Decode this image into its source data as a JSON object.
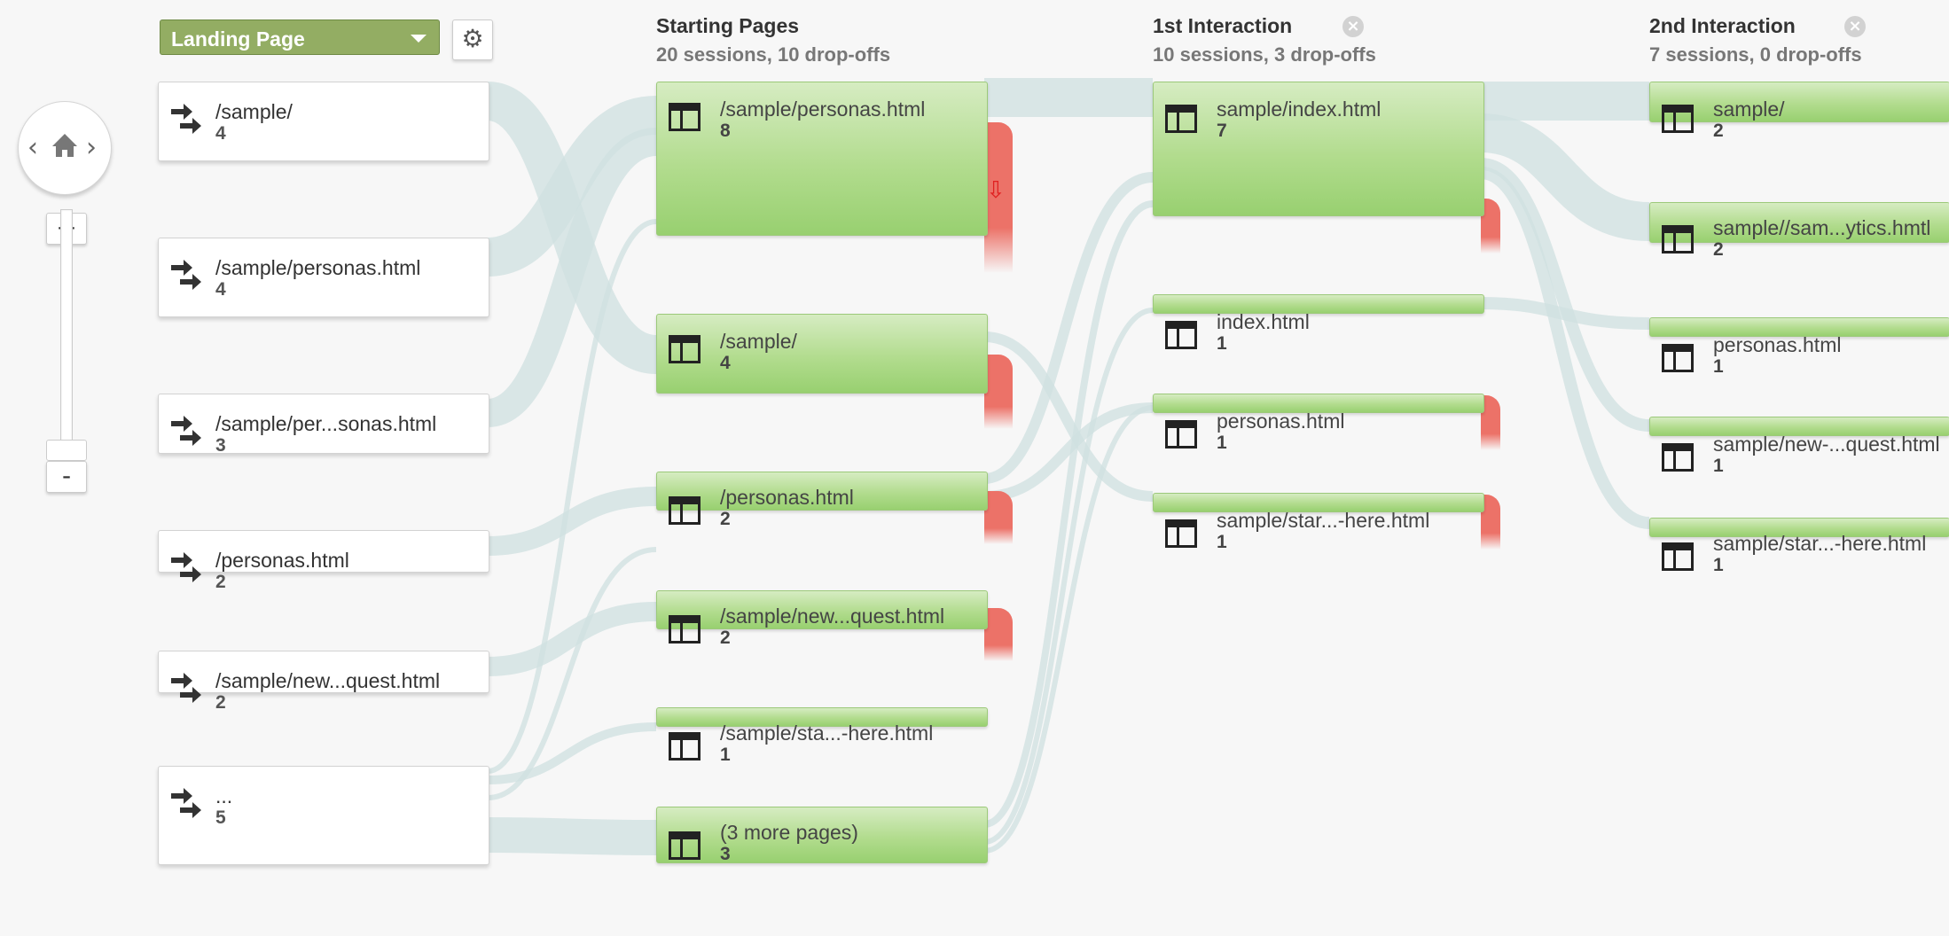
{
  "dimension_selector": {
    "label": "Landing Page"
  },
  "columns": [
    {
      "title": "Starting Pages",
      "subtitle": "20 sessions, 10 drop-offs"
    },
    {
      "title": "1st Interaction",
      "subtitle": "10 sessions, 3 drop-offs"
    },
    {
      "title": "2nd Interaction",
      "subtitle": "7 sessions, 0 drop-offs"
    }
  ],
  "landing_pages": [
    {
      "name": "/sample/",
      "count": "4"
    },
    {
      "name": "/sample/personas.html",
      "count": "4"
    },
    {
      "name": "/sample/per...sonas.html",
      "count": "3"
    },
    {
      "name": "/personas.html",
      "count": "2"
    },
    {
      "name": "/sample/new...quest.html",
      "count": "2"
    },
    {
      "name": "...",
      "count": "5"
    }
  ],
  "starting_pages": [
    {
      "name": "/sample/personas.html",
      "count": "8"
    },
    {
      "name": "/sample/",
      "count": "4"
    },
    {
      "name": "/personas.html",
      "count": "2"
    },
    {
      "name": "/sample/new...quest.html",
      "count": "2"
    },
    {
      "name": "/sample/sta...-here.html",
      "count": "1"
    },
    {
      "name": "(3 more pages)",
      "count": "3"
    }
  ],
  "first_interaction": [
    {
      "name": "sample/index.html",
      "count": "7"
    },
    {
      "name": "index.html",
      "count": "1"
    },
    {
      "name": "personas.html",
      "count": "1"
    },
    {
      "name": "sample/star...-here.html",
      "count": "1"
    }
  ],
  "second_interaction": [
    {
      "name": "sample/",
      "count": "2"
    },
    {
      "name": "sample//sam...ytics.hmtl",
      "count": "2"
    },
    {
      "name": "personas.html",
      "count": "1"
    },
    {
      "name": "sample/new-...quest.html",
      "count": "1"
    },
    {
      "name": "sample/star...-here.html",
      "count": "1"
    }
  ],
  "colors": {
    "node_green": "#98d070",
    "dropoff_red": "#ec7268",
    "flow": "#cfe0e0",
    "selector": "#93ad63"
  }
}
